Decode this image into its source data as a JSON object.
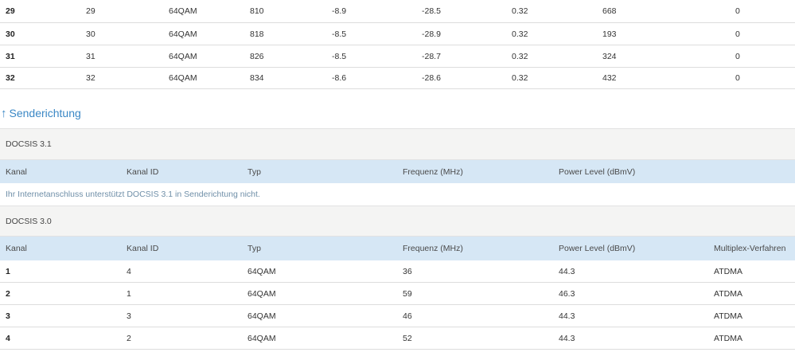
{
  "downstream_rows": [
    {
      "kanal": "29",
      "kanal_id": "29",
      "typ": "64QAM",
      "frequenz": "810",
      "power": "-8.9",
      "mse": "-28.5",
      "latenz": "0.32",
      "korrigierbar": "668",
      "nicht_korrigierbar": "0"
    },
    {
      "kanal": "30",
      "kanal_id": "30",
      "typ": "64QAM",
      "frequenz": "818",
      "power": "-8.5",
      "mse": "-28.9",
      "latenz": "0.32",
      "korrigierbar": "193",
      "nicht_korrigierbar": "0"
    },
    {
      "kanal": "31",
      "kanal_id": "31",
      "typ": "64QAM",
      "frequenz": "826",
      "power": "-8.5",
      "mse": "-28.7",
      "latenz": "0.32",
      "korrigierbar": "324",
      "nicht_korrigierbar": "0"
    },
    {
      "kanal": "32",
      "kanal_id": "32",
      "typ": "64QAM",
      "frequenz": "834",
      "power": "-8.6",
      "mse": "-28.6",
      "latenz": "0.32",
      "korrigierbar": "432",
      "nicht_korrigierbar": "0"
    }
  ],
  "upstream": {
    "title": "Senderichtung",
    "arrow_glyph": "↑",
    "docsis31": {
      "label": "DOCSIS 3.1",
      "headers": [
        "Kanal",
        "Kanal ID",
        "Typ",
        "Frequenz (MHz)",
        "Power Level (dBmV)"
      ],
      "note": "Ihr Internetanschluss unterstützt DOCSIS 3.1 in Senderichtung nicht."
    },
    "docsis30": {
      "label": "DOCSIS 3.0",
      "headers": [
        "Kanal",
        "Kanal ID",
        "Typ",
        "Frequenz (MHz)",
        "Power Level (dBmV)",
        "Multiplex-Verfahren"
      ],
      "rows": [
        {
          "kanal": "1",
          "kanal_id": "4",
          "typ": "64QAM",
          "frequenz": "36",
          "power": "44.3",
          "multiplex": "ATDMA"
        },
        {
          "kanal": "2",
          "kanal_id": "1",
          "typ": "64QAM",
          "frequenz": "59",
          "power": "46.3",
          "multiplex": "ATDMA"
        },
        {
          "kanal": "3",
          "kanal_id": "3",
          "typ": "64QAM",
          "frequenz": "46",
          "power": "44.3",
          "multiplex": "ATDMA"
        },
        {
          "kanal": "4",
          "kanal_id": "2",
          "typ": "64QAM",
          "frequenz": "52",
          "power": "44.3",
          "multiplex": "ATDMA"
        }
      ]
    }
  }
}
